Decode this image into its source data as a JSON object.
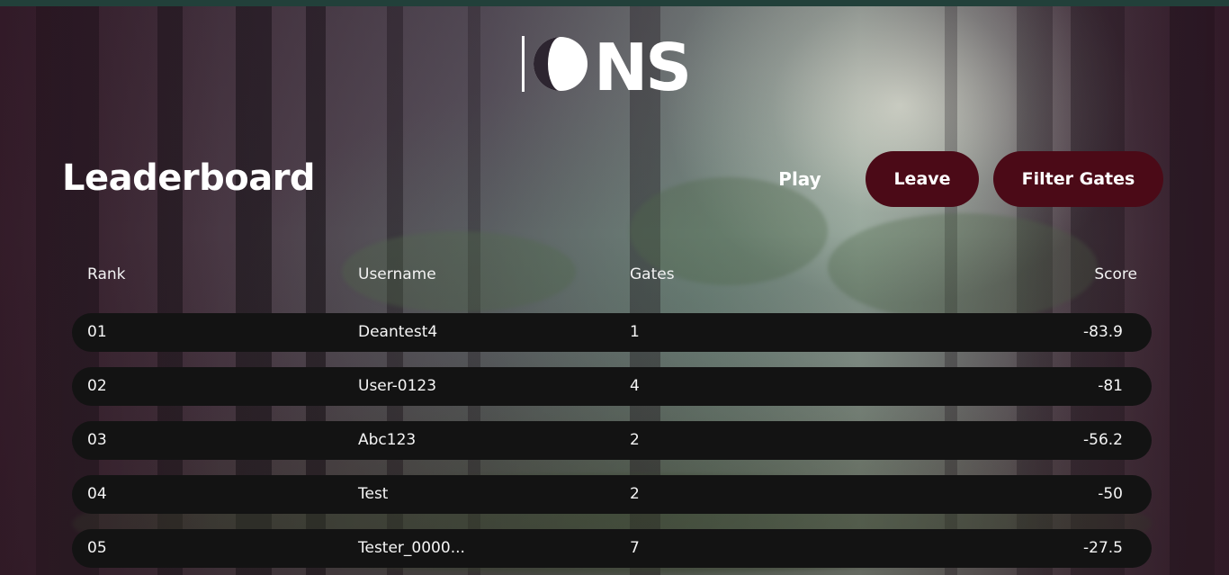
{
  "app": {
    "logo_text": "IONS"
  },
  "header": {
    "title": "Leaderboard",
    "play_label": "Play",
    "leave_label": "Leave",
    "filter_label": "Filter Gates"
  },
  "table": {
    "columns": {
      "rank": "Rank",
      "username": "Username",
      "gates": "Gates",
      "score": "Score"
    },
    "rows": [
      {
        "rank": "01",
        "username": "Deantest4",
        "gates": "1",
        "score": "-83.9"
      },
      {
        "rank": "02",
        "username": "User-0123",
        "gates": "4",
        "score": "-81"
      },
      {
        "rank": "03",
        "username": "Abc123",
        "gates": "2",
        "score": "-56.2"
      },
      {
        "rank": "04",
        "username": "Test",
        "gates": "2",
        "score": "-50"
      },
      {
        "rank": "05",
        "username": "Tester_0000...",
        "gates": "7",
        "score": "-27.5"
      }
    ]
  },
  "colors": {
    "button_bg": "#4b0a17",
    "row_bg": "#131313",
    "text": "#ffffff"
  }
}
